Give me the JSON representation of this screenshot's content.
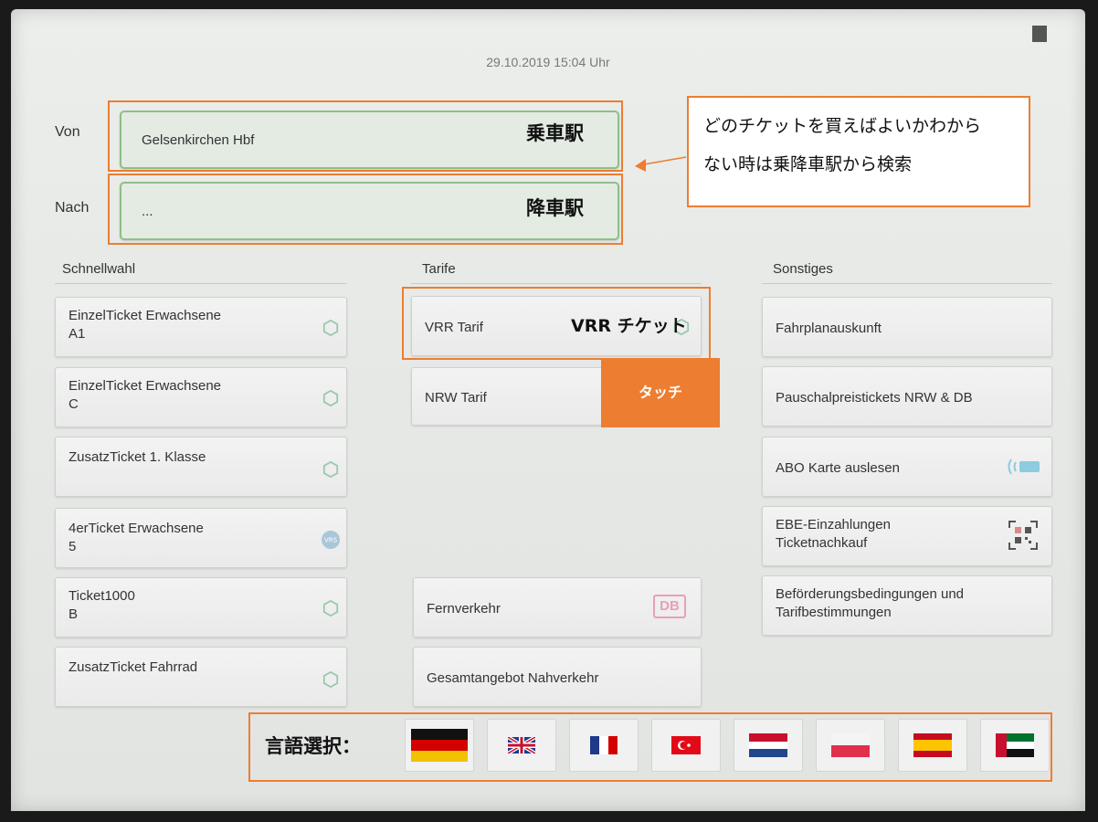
{
  "header": {
    "datetime": "29.10.2019  15:04  Uhr"
  },
  "route": {
    "from_label": "Von",
    "from_value": "Gelsenkirchen Hbf",
    "from_annotation": "乗車駅",
    "to_label": "Nach",
    "to_value": "...",
    "to_annotation": "降車駅"
  },
  "callout": {
    "line1": "どのチケットを買えばよいかわから",
    "line2": "ない時は乗降車駅から検索"
  },
  "columns": {
    "quick": {
      "title": "Schnellwahl",
      "items": [
        {
          "line1": "EinzelTicket Erwachsene",
          "line2": "A1",
          "icon": "vrr-hex-icon"
        },
        {
          "line1": "EinzelTicket Erwachsene",
          "line2": "C",
          "icon": "vrr-hex-icon"
        },
        {
          "line1": "ZusatzTicket 1. Klasse",
          "line2": "",
          "icon": "vrr-hex-icon"
        },
        {
          "line1": "4erTicket Erwachsene",
          "line2": "5",
          "icon": "vrs-logo-icon"
        },
        {
          "line1": "Ticket1000",
          "line2": "B",
          "icon": "vrr-hex-icon"
        },
        {
          "line1": "ZusatzTicket Fahrrad",
          "line2": "",
          "icon": "vrr-hex-icon"
        }
      ]
    },
    "tariffs": {
      "title": "Tarife",
      "items": [
        {
          "label": "VRR Tarif",
          "annotation": "VRR チケット"
        },
        {
          "label": "NRW Tarif"
        },
        {
          "label": "Fernverkehr",
          "badge": "DB"
        },
        {
          "label": "Gesamtangebot Nahverkehr"
        }
      ],
      "touch_label": "タッチ"
    },
    "other": {
      "title": "Sonstiges",
      "items": [
        {
          "line1": "Fahrplanauskunft",
          "line2": ""
        },
        {
          "line1": "Pauschalpreistickets NRW & DB",
          "line2": ""
        },
        {
          "line1": "ABO Karte auslesen",
          "line2": "",
          "icon": "contactless-card-icon"
        },
        {
          "line1": "EBE-Einzahlungen",
          "line2": "Ticketnachkauf",
          "icon": "qr-code-icon"
        },
        {
          "line1": "Beförderungsbedingungen und",
          "line2": "Tarifbestimmungen"
        }
      ]
    }
  },
  "language": {
    "label": "言語選択：",
    "flags": [
      "german-flag-icon",
      "uk-flag-icon",
      "french-flag-icon",
      "turkish-flag-icon",
      "dutch-flag-icon",
      "polish-flag-icon",
      "spanish-flag-icon",
      "uae-flag-icon"
    ]
  },
  "colors": {
    "accent_orange": "#ed7d31",
    "field_green": "#8fbf88"
  }
}
